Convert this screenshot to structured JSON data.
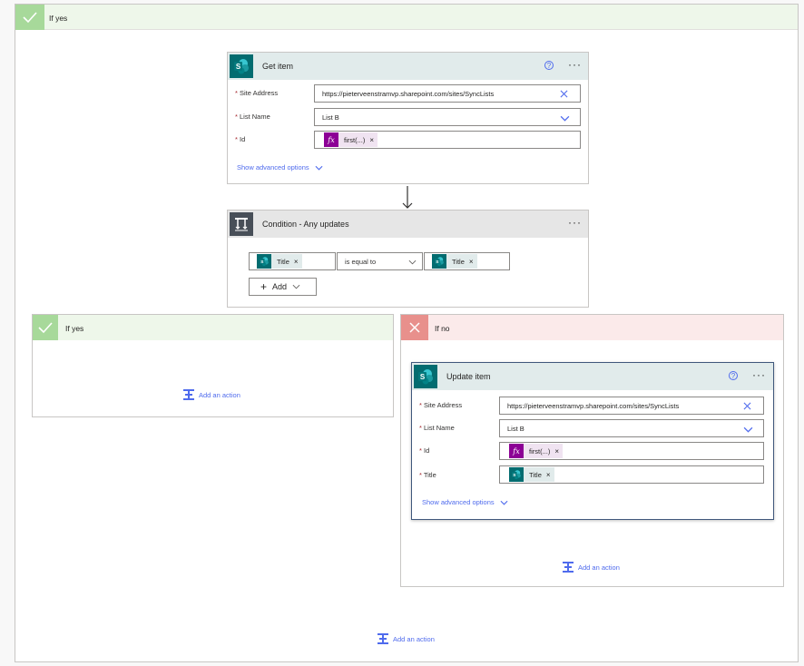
{
  "outer": {
    "label": "If yes",
    "add_action": "Add an action"
  },
  "get_item": {
    "title": "Get item",
    "fields": [
      {
        "label": "Site Address",
        "value": "https://pieterveenstramvp.sharepoint.com/sites/SyncLists"
      },
      {
        "label": "List Name",
        "value": "List B"
      },
      {
        "label": "Id",
        "token": "first(...)"
      }
    ],
    "advanced": "Show advanced options"
  },
  "condition": {
    "title": "Condition - Any updates",
    "left_token": "Title",
    "operator": "is equal to",
    "right_token": "Title",
    "add_label": "Add"
  },
  "branch_yes": {
    "label": "If yes",
    "add_action": "Add an action"
  },
  "branch_no": {
    "label": "If no",
    "add_action": "Add an action"
  },
  "update_item": {
    "title": "Update item",
    "fields": [
      {
        "label": "Site Address",
        "value": "https://pieterveenstramvp.sharepoint.com/sites/SyncLists"
      },
      {
        "label": "List Name",
        "value": "List B"
      },
      {
        "label": "Id",
        "token": "first(...)"
      },
      {
        "label": "Title",
        "token": "Title"
      }
    ],
    "advanced": "Show advanced options"
  },
  "colors": {
    "accent": "#4f6bed",
    "sharepoint": "#036c70",
    "yes": "#a7d99a",
    "no": "#e8908c",
    "fx": "#8c0095"
  }
}
